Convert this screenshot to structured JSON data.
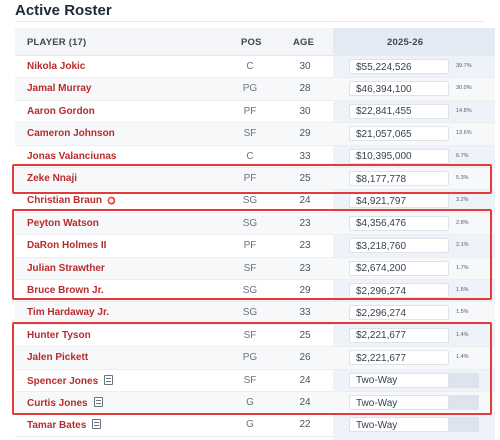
{
  "title": "Active Roster",
  "columns": {
    "player": "PLAYER (17)",
    "pos": "POS",
    "age": "AGE",
    "season": "2025-26"
  },
  "players": [
    {
      "name": "Nikola Jokic",
      "pos": "C",
      "age": "30",
      "salary": "$55,224,526",
      "pct": "39.7%",
      "icon": ""
    },
    {
      "name": "Jamal Murray",
      "pos": "PG",
      "age": "28",
      "salary": "$46,394,100",
      "pct": "30.0%",
      "icon": ""
    },
    {
      "name": "Aaron Gordon",
      "pos": "PF",
      "age": "30",
      "salary": "$22,841,455",
      "pct": "14.8%",
      "icon": ""
    },
    {
      "name": "Cameron Johnson",
      "pos": "SF",
      "age": "29",
      "salary": "$21,057,065",
      "pct": "13.6%",
      "icon": ""
    },
    {
      "name": "Jonas Valanciunas",
      "pos": "C",
      "age": "33",
      "salary": "$10,395,000",
      "pct": "6.7%",
      "icon": ""
    },
    {
      "name": "Zeke Nnaji",
      "pos": "PF",
      "age": "25",
      "salary": "$8,177,778",
      "pct": "5.3%",
      "icon": ""
    },
    {
      "name": "Christian Braun",
      "pos": "SG",
      "age": "24",
      "salary": "$4,921,797",
      "pct": "3.2%",
      "icon": "tag-icon"
    },
    {
      "name": "Peyton Watson",
      "pos": "SG",
      "age": "23",
      "salary": "$4,356,476",
      "pct": "2.8%",
      "icon": ""
    },
    {
      "name": "DaRon Holmes II",
      "pos": "PF",
      "age": "23",
      "salary": "$3,218,760",
      "pct": "2.1%",
      "icon": ""
    },
    {
      "name": "Julian Strawther",
      "pos": "SF",
      "age": "23",
      "salary": "$2,674,200",
      "pct": "1.7%",
      "icon": ""
    },
    {
      "name": "Bruce Brown Jr.",
      "pos": "SG",
      "age": "29",
      "salary": "$2,296,274",
      "pct": "1.5%",
      "icon": ""
    },
    {
      "name": "Tim Hardaway Jr.",
      "pos": "SG",
      "age": "33",
      "salary": "$2,296,274",
      "pct": "1.5%",
      "icon": ""
    },
    {
      "name": "Hunter Tyson",
      "pos": "SF",
      "age": "25",
      "salary": "$2,221,677",
      "pct": "1.4%",
      "icon": ""
    },
    {
      "name": "Jalen Pickett",
      "pos": "PG",
      "age": "26",
      "salary": "$2,221,677",
      "pct": "1.4%",
      "icon": ""
    },
    {
      "name": "Spencer Jones",
      "pos": "SF",
      "age": "24",
      "salary": "Two-Way",
      "pct": "",
      "icon": "note-icon"
    },
    {
      "name": "Curtis Jones",
      "pos": "G",
      "age": "24",
      "salary": "Two-Way",
      "pct": "",
      "icon": "note-icon"
    },
    {
      "name": "Tamar Bates",
      "pos": "G",
      "age": "22",
      "salary": "Two-Way",
      "pct": "",
      "icon": "note-icon"
    }
  ],
  "colors": {
    "player_link": "#b72c2c",
    "highlight": "#e23b3b",
    "salary_column": "#eef3fa"
  }
}
